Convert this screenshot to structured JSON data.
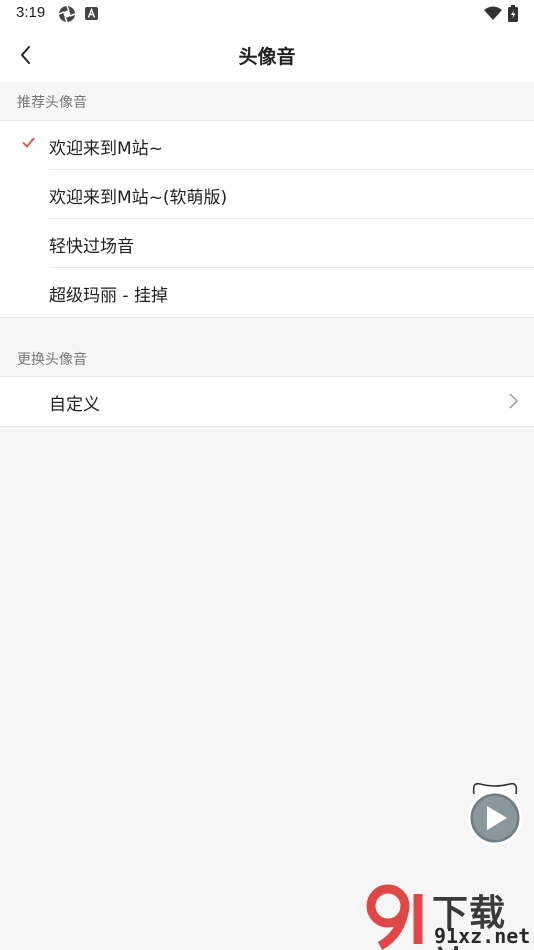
{
  "status_bar": {
    "time": "3:19"
  },
  "header": {
    "title": "头像音"
  },
  "recommend_section": {
    "title": "推荐头像音",
    "items": [
      {
        "label": "欢迎来到M站~",
        "selected": true
      },
      {
        "label": "欢迎来到M站~(软萌版)",
        "selected": false
      },
      {
        "label": "轻快过场音",
        "selected": false
      },
      {
        "label": "超级玛丽 - 挂掉",
        "selected": false
      }
    ]
  },
  "change_section": {
    "title": "更换头像音",
    "items": [
      {
        "label": "自定义"
      }
    ]
  },
  "watermark": {
    "brand": "下载站",
    "url": "91xz.net"
  },
  "colors": {
    "accent": "#e0504a",
    "background": "#f6f6f6"
  }
}
